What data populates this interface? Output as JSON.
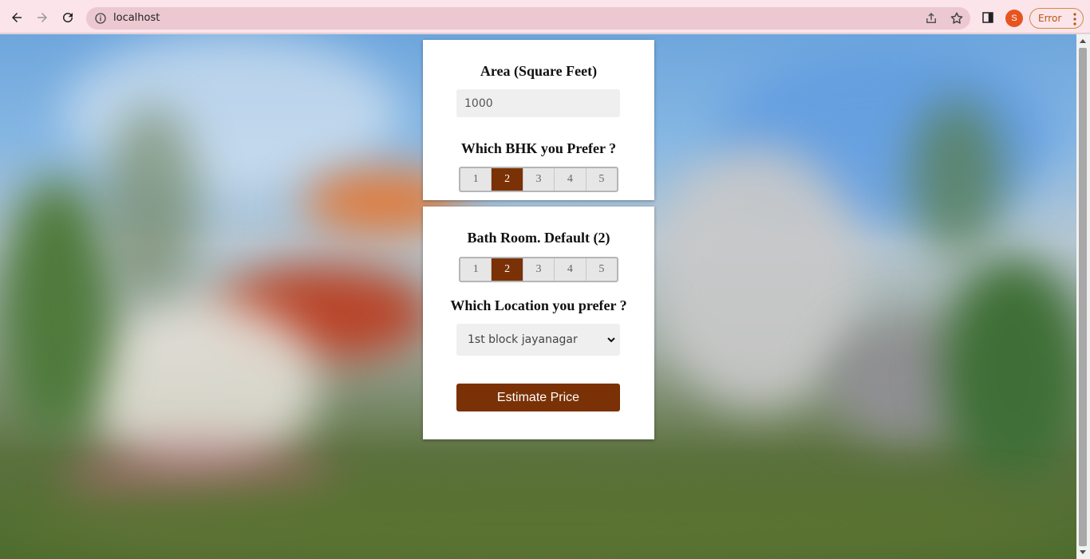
{
  "browser": {
    "url": "localhost",
    "profile_initial": "S",
    "error_label": "Error",
    "icons": [
      "back-arrow-icon",
      "forward-arrow-icon",
      "reload-icon",
      "info-icon",
      "share-icon",
      "star-icon",
      "side-panel-icon",
      "more-vert-icon"
    ]
  },
  "form": {
    "area_label": "Area (Square Feet)",
    "area_value": "1000",
    "bhk_label": "Which BHK you Prefer ?",
    "bhk_options": [
      "1",
      "2",
      "3",
      "4",
      "5"
    ],
    "bhk_selected": "2",
    "bath_label": "Bath Room. Default (2)",
    "bath_options": [
      "1",
      "2",
      "3",
      "4",
      "5"
    ],
    "bath_selected": "2",
    "location_label": "Which Location you prefer ?",
    "location_selected": "1st block jayanagar",
    "estimate_button": "Estimate Price"
  },
  "colors": {
    "accent": "#7a3106",
    "toolbar_bg": "#fbe4ea",
    "omnibox_bg": "#ecc8d1"
  }
}
